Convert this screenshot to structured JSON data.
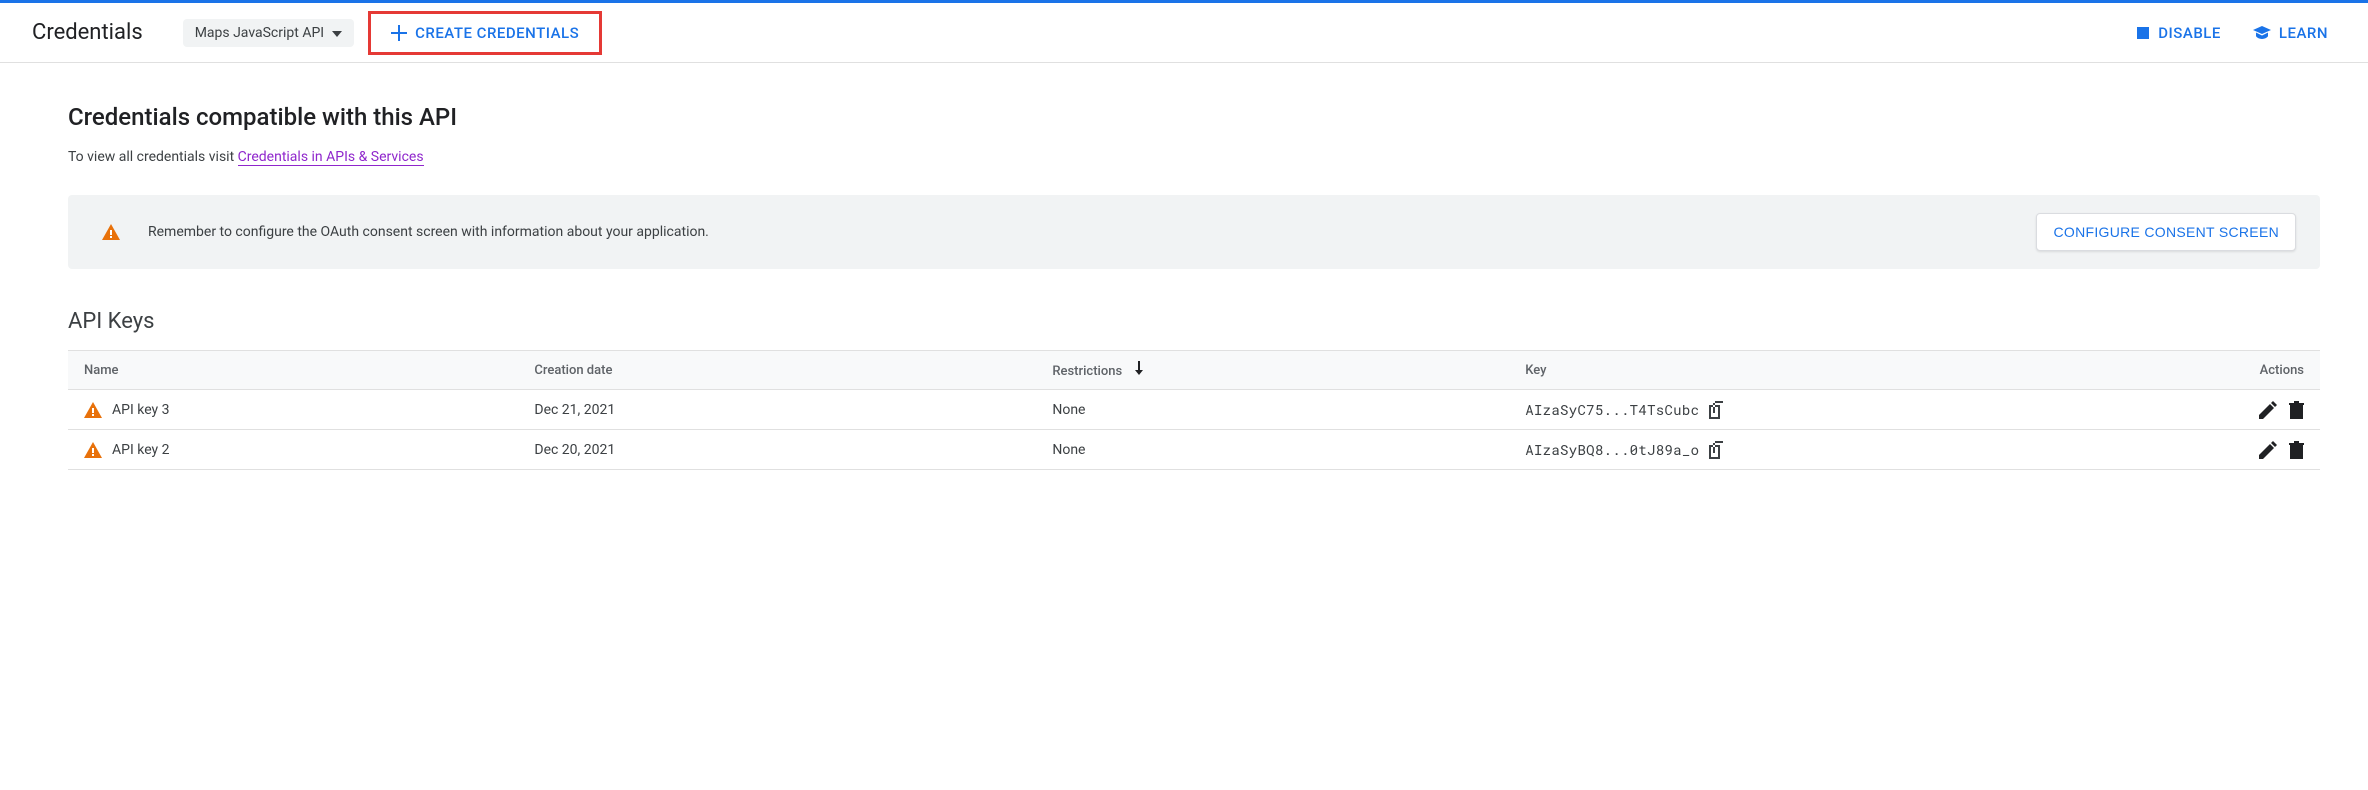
{
  "header": {
    "title": "Credentials",
    "api_selector": "Maps JavaScript API",
    "create_label": "Create Credentials",
    "disable_label": "Disable",
    "learn_label": "Learn"
  },
  "main": {
    "section_title": "Credentials compatible with this API",
    "desc_prefix": "To view all credentials visit ",
    "desc_link": "Credentials in APIs & Services",
    "banner_text": "Remember to configure the OAuth consent screen with information about your application.",
    "banner_btn": "Configure Consent Screen",
    "api_keys_title": "API Keys",
    "columns": {
      "name": "Name",
      "created": "Creation date",
      "restrictions": "Restrictions",
      "key": "Key",
      "actions": "Actions"
    },
    "rows": [
      {
        "name": "API key 3",
        "created": "Dec 21, 2021",
        "restrictions": "None",
        "key": "AIzaSyC75...T4TsCubc"
      },
      {
        "name": "API key 2",
        "created": "Dec 20, 2021",
        "restrictions": "None",
        "key": "AIzaSyBQ8...0tJ89a_o"
      }
    ]
  }
}
